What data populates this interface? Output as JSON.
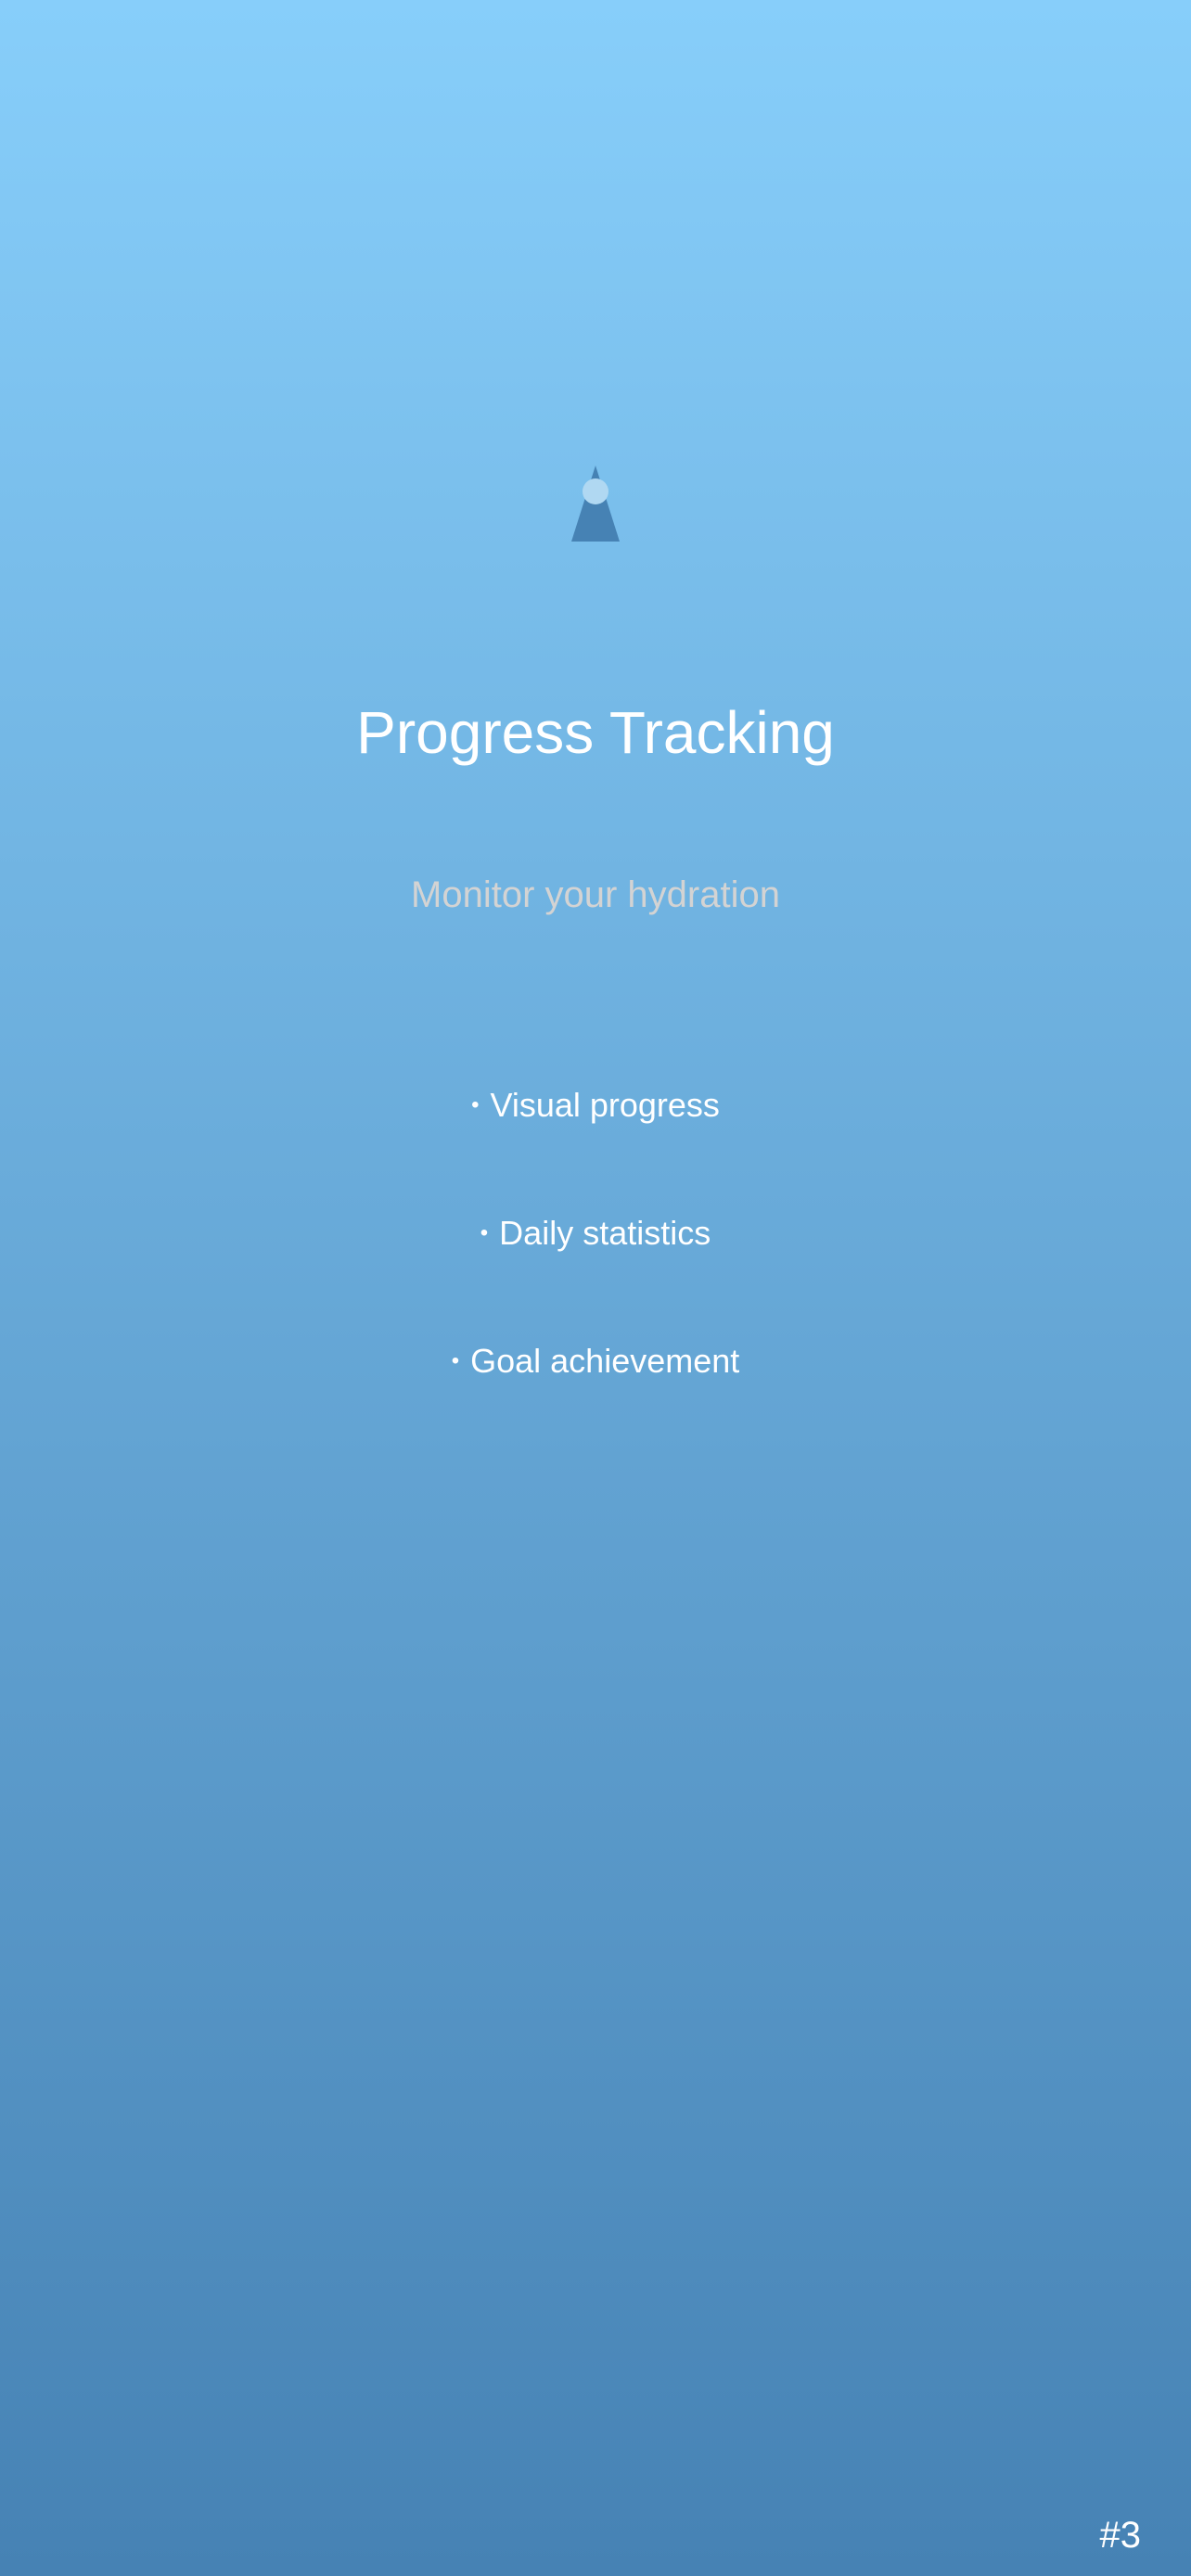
{
  "onboarding": {
    "logo_icon": "water-drop-icon",
    "title": "Progress Tracking",
    "subtitle": "Monitor your hydration",
    "bullet_glyph": "•",
    "features": [
      {
        "label": "Visual progress"
      },
      {
        "label": "Daily statistics"
      },
      {
        "label": "Goal achievement"
      }
    ],
    "page_indicator": "#3"
  },
  "colors": {
    "gradient_top": "#87CEFA",
    "gradient_bottom": "#4682B4",
    "title_text": "#FFFFFF",
    "subtitle_text": "#D3D3D3",
    "icon_fill": "#4682B4",
    "icon_accent": "#B0D8F2"
  }
}
